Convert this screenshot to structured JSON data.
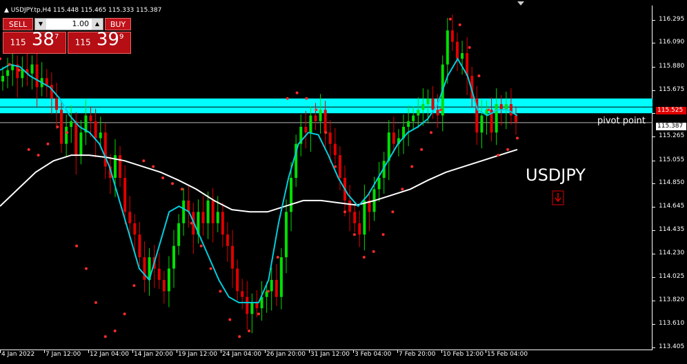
{
  "window": {
    "title": "USDJPY.tp,H4  115.448 115.465 115.333 115.387"
  },
  "trade_panel": {
    "sell_label": "SELL",
    "buy_label": "BUY",
    "lot_value": "1.00",
    "sell_price_prefix": "115",
    "sell_price_main": "38",
    "sell_price_sup": "7",
    "buy_price_prefix": "115",
    "buy_price_main": "39",
    "buy_price_sup": "9"
  },
  "price_axis": {
    "labels": [
      "116.295",
      "116.090",
      "115.880",
      "115.675",
      "115.470",
      "115.265",
      "115.055",
      "114.850",
      "114.645",
      "114.435",
      "114.230",
      "114.025",
      "113.820",
      "113.610",
      "113.405"
    ],
    "pivot_price_label": "115.525",
    "current_price_label": "115.387"
  },
  "time_axis": {
    "labels": [
      "4 Jan 2022",
      "7 Jan 12:00",
      "12 Jan 04:00",
      "14 Jan 20:00",
      "19 Jan 12:00",
      "24 Jan 04:00",
      "26 Jan 20:00",
      "31 Jan 12:00",
      "3 Feb 04:00",
      "7 Feb 20:00",
      "10 Feb 12:00",
      "15 Feb 04:00"
    ]
  },
  "annotations": {
    "pivot_text": "pivot point",
    "symbol_text": "USDJPY"
  },
  "colors": {
    "bull": "#00e000",
    "bear": "#e00000",
    "ma_fast": "#00d0e0",
    "ma_slow": "#ffffff",
    "sar": "#ff2a2a",
    "zone": "#00ffff"
  },
  "chart_data": {
    "type": "candlestick",
    "ylim": [
      113.38,
      116.42
    ],
    "zone": [
      115.47,
      115.6
    ],
    "pivot": 115.525,
    "current": 115.387,
    "closes": [
      115.8,
      115.85,
      115.9,
      115.78,
      115.86,
      115.82,
      115.9,
      115.7,
      115.78,
      115.72,
      115.6,
      115.5,
      115.2,
      115.35,
      115.4,
      115.1,
      115.3,
      115.45,
      115.4,
      115.25,
      115.3,
      115.0,
      114.9,
      115.1,
      114.9,
      114.6,
      114.5,
      114.4,
      114.2,
      114.0,
      114.2,
      114.1,
      114.0,
      113.9,
      114.1,
      114.3,
      114.5,
      114.7,
      114.6,
      114.4,
      114.6,
      114.5,
      114.7,
      114.5,
      114.6,
      114.4,
      114.3,
      114.1,
      113.9,
      113.85,
      113.7,
      113.8,
      113.75,
      113.85,
      113.9,
      114.0,
      113.85,
      114.2,
      114.6,
      114.9,
      115.2,
      115.35,
      115.3,
      115.45,
      115.4,
      115.5,
      115.3,
      115.2,
      115.1,
      114.9,
      114.7,
      114.6,
      114.5,
      114.4,
      114.7,
      114.6,
      114.8,
      114.9,
      115.05,
      115.3,
      115.2,
      115.25,
      115.35,
      115.4,
      115.45,
      115.5,
      115.55,
      115.6,
      115.5,
      115.45,
      115.9,
      116.2,
      116.1,
      115.95,
      116.0,
      115.8,
      115.6,
      115.3,
      115.45,
      115.5,
      115.3,
      115.55,
      115.5,
      115.55,
      115.45,
      115.39
    ],
    "ma_fast": [
      115.85,
      115.9,
      115.88,
      115.8,
      115.75,
      115.7,
      115.6,
      115.45,
      115.35,
      115.3,
      115.2,
      115.0,
      114.7,
      114.4,
      114.1,
      114.0,
      114.3,
      114.6,
      114.65,
      114.6,
      114.4,
      114.2,
      114.0,
      113.85,
      113.8,
      113.8,
      113.8,
      114.0,
      114.5,
      114.9,
      115.2,
      115.3,
      115.28,
      115.1,
      114.9,
      114.75,
      114.65,
      114.75,
      114.9,
      115.05,
      115.2,
      115.3,
      115.35,
      115.42,
      115.55,
      115.8,
      115.95,
      115.8,
      115.5,
      115.45,
      115.5,
      115.5,
      115.45
    ],
    "ma_slow": [
      114.65,
      114.8,
      114.95,
      115.05,
      115.1,
      115.1,
      115.08,
      115.05,
      115.0,
      114.95,
      114.88,
      114.8,
      114.7,
      114.62,
      114.6,
      114.6,
      114.65,
      114.7,
      114.7,
      114.68,
      114.66,
      114.7,
      114.75,
      114.8,
      114.88,
      114.95,
      115.0,
      115.05,
      115.1,
      115.15
    ],
    "sar": [
      115.95,
      115.9,
      115.85,
      115.15,
      115.1,
      115.2,
      115.35,
      115.3,
      114.3,
      114.1,
      113.8,
      113.5,
      113.55,
      113.7,
      113.95,
      115.05,
      115.0,
      114.9,
      114.85,
      114.8,
      114.5,
      114.3,
      114.1,
      113.9,
      113.65,
      113.5,
      113.55,
      113.7,
      113.9,
      114.2,
      115.6,
      115.65,
      115.6,
      115.5,
      115.3,
      115.0,
      114.6,
      114.4,
      114.2,
      114.25,
      114.4,
      114.6,
      114.8,
      115.0,
      115.15,
      115.3,
      115.5,
      116.3,
      116.25,
      116.05,
      115.8,
      115.5,
      115.1,
      115.15,
      115.25
    ]
  }
}
